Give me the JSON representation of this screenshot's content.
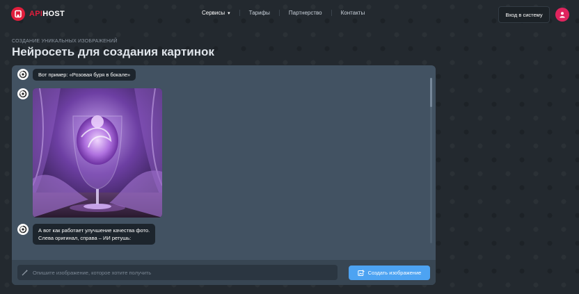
{
  "header": {
    "logo": {
      "api": "API",
      "host": "HOST"
    },
    "nav": [
      {
        "label": "Сервисы",
        "has_dropdown": true
      },
      {
        "label": "Тарифы"
      },
      {
        "label": "Партнерство"
      },
      {
        "label": "Контакты"
      }
    ],
    "login_label": "Вход в систему"
  },
  "page": {
    "subtitle": "Создание уникальных изображений",
    "title": "Нейросеть для создания картинок"
  },
  "chat": {
    "messages": [
      {
        "text": "Вот пример: «Розовая буря в бокале»"
      },
      {
        "type": "image",
        "icon": "generated-image-wine-glass"
      },
      {
        "lines": [
          "А вот как работает улучшение качества фото.",
          "Слева оригинал, справа – ИИ ретушь:"
        ]
      }
    ],
    "input_placeholder": "Опишите изображение, которое хотите получить",
    "input_value": "",
    "create_label": "Создать изображение"
  },
  "colors": {
    "brand": "#e01e3c",
    "accent": "#4da3f2",
    "panel": "#425262",
    "background": "#23292f"
  }
}
